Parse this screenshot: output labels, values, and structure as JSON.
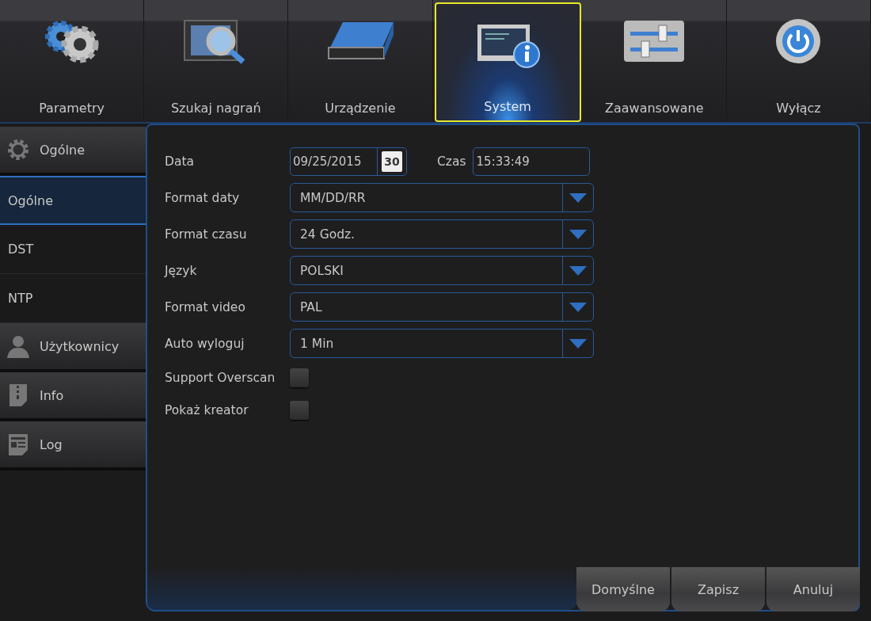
{
  "top_menu": [
    {
      "label": "Parametry",
      "selected": false
    },
    {
      "label": "Szukaj nagrań",
      "selected": false
    },
    {
      "label": "Urządzenie",
      "selected": false
    },
    {
      "label": "System",
      "selected": true
    },
    {
      "label": "Zaawansowane",
      "selected": false
    },
    {
      "label": "Wyłącz",
      "selected": false
    }
  ],
  "sidebar": [
    {
      "kind": "section",
      "label": "Ogólne",
      "selected": false
    },
    {
      "kind": "sub",
      "label": "Ogólne",
      "selected": true
    },
    {
      "kind": "sub",
      "label": "DST",
      "selected": false
    },
    {
      "kind": "sub",
      "label": "NTP",
      "selected": false
    },
    {
      "kind": "section",
      "label": "Użytkownicy",
      "selected": false
    },
    {
      "kind": "section",
      "label": "Info",
      "selected": false
    },
    {
      "kind": "section",
      "label": "Log",
      "selected": false
    }
  ],
  "form": [
    {
      "kind": "datetime",
      "label": "Data",
      "value": "09/25/2015",
      "calendar_day": "30",
      "time_label": "Czas",
      "time_value": "15:33:49"
    },
    {
      "kind": "select",
      "label": "Format daty",
      "value": "MM/DD/RR"
    },
    {
      "kind": "select",
      "label": "Format czasu",
      "value": "24 Godz."
    },
    {
      "kind": "select",
      "label": "Język",
      "value": "POLSKI"
    },
    {
      "kind": "select",
      "label": "Format video",
      "value": "PAL"
    },
    {
      "kind": "select",
      "label": "Auto wyloguj",
      "value": "1 Min"
    },
    {
      "kind": "checkbox",
      "label": "Support Overscan",
      "checked": false
    },
    {
      "kind": "checkbox",
      "label": "Pokaż kreator",
      "checked": false
    }
  ],
  "buttons": [
    "Domyślne",
    "Zapisz",
    "Anuluj"
  ]
}
